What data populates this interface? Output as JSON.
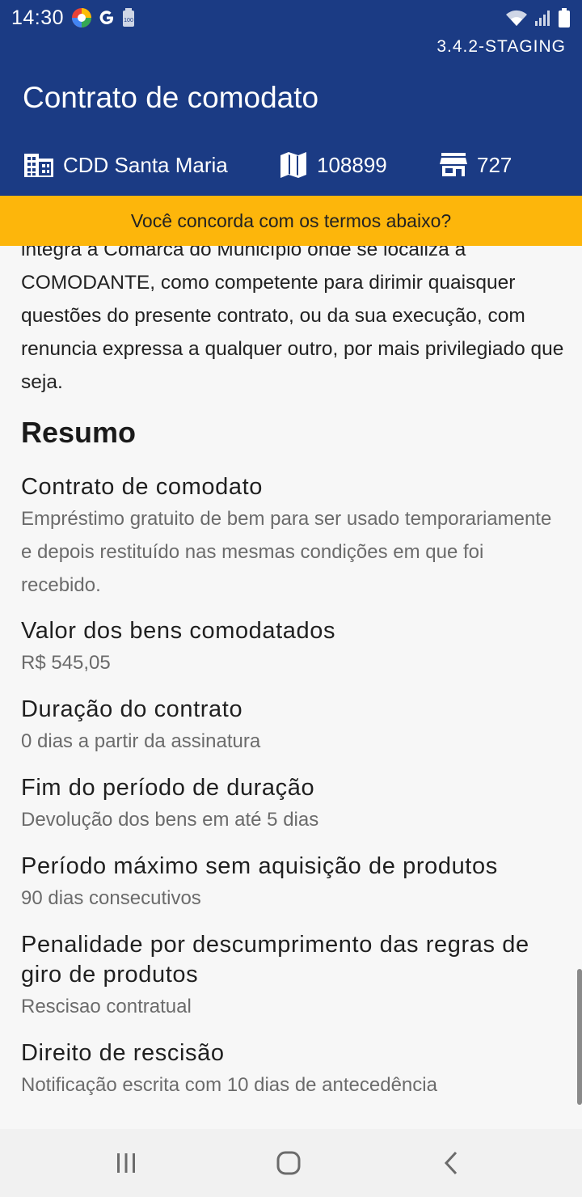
{
  "status_bar": {
    "time": "14:30",
    "left_icons": [
      "browser-app-icon",
      "google-g-icon",
      "battery-saver-icon"
    ],
    "right_icons": [
      "wifi-icon",
      "signal-icon",
      "battery-icon"
    ]
  },
  "header": {
    "version": "3.4.2-STAGING",
    "title": "Contrato de comodato",
    "info": [
      {
        "icon": "building-icon",
        "label": "CDD Santa Maria"
      },
      {
        "icon": "map-icon",
        "label": "108899"
      },
      {
        "icon": "store-icon",
        "label": "727"
      }
    ]
  },
  "banner": {
    "text": "Você concorda com os termos abaixo?"
  },
  "contract": {
    "clause_text": "integra a Comarca do Município onde se localiza a COMODANTE, como competente para dirimir quaisquer questões do presente contrato, ou da sua execução, com renuncia expressa a qualquer outro, por mais privilegiado que seja."
  },
  "summary": {
    "title": "Resumo",
    "items": [
      {
        "title": "Contrato de comodato",
        "value": "Empréstimo gratuito de bem para ser usado temporariamente e depois restituído nas mesmas condições em que foi recebido."
      },
      {
        "title": "Valor dos bens comodatados",
        "value": "R$ 545,05"
      },
      {
        "title": "Duração do contrato",
        "value": "0 dias a partir da assinatura"
      },
      {
        "title": "Fim do período de duração",
        "value": "Devolução dos bens em até 5 dias"
      },
      {
        "title": "Período máximo sem aquisição de produtos",
        "value": "90 dias consecutivos"
      },
      {
        "title": "Penalidade por descumprimento das regras de giro de produtos",
        "value": "Rescisao contratual"
      },
      {
        "title": "Direito de rescisão",
        "value": "Notificação escrita com 10 dias de antecedência"
      }
    ]
  },
  "navigation": {
    "buttons": [
      "recent-apps-icon",
      "home-icon",
      "back-icon"
    ]
  },
  "colors": {
    "header_bg": "#1b3b84",
    "banner_bg": "#fdb60b",
    "content_bg": "#f7f7f7"
  }
}
